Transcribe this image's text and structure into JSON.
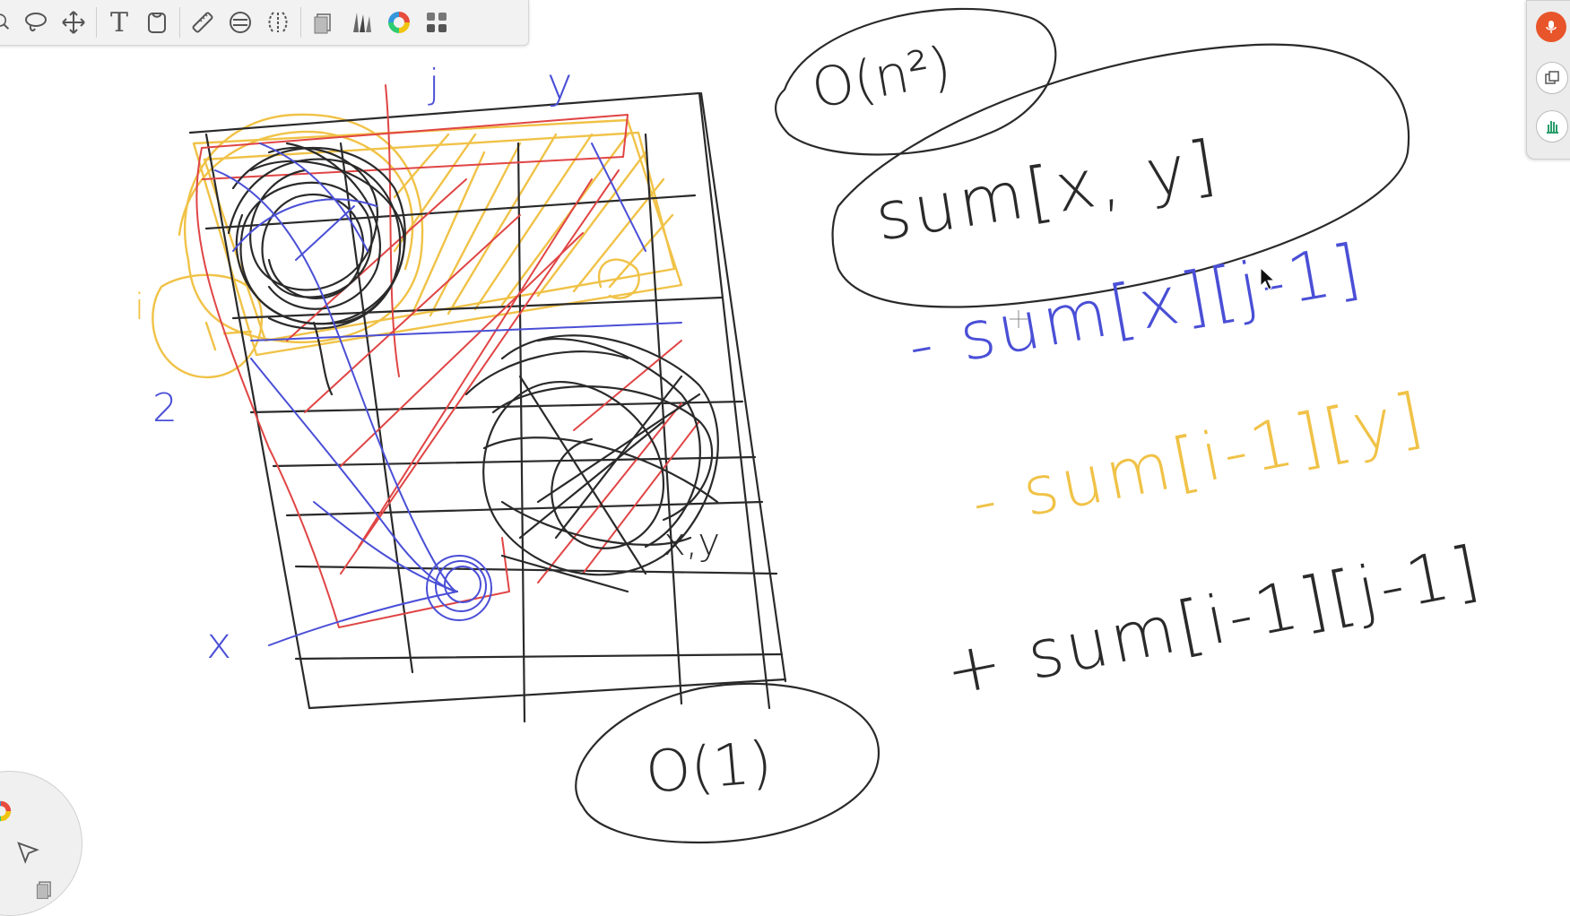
{
  "toolbar": {
    "tools": [
      "magnify-icon",
      "lasso-icon",
      "move-icon",
      "text-tool-icon",
      "fill-icon",
      "ruler-icon",
      "symmetry-icon",
      "perspective-icon",
      "layers-icon",
      "brush-library-icon",
      "color-wheel-icon",
      "menu-grid-icon"
    ],
    "text_tool_glyph": "T"
  },
  "sidepanel": {
    "buttons": [
      "mic-icon",
      "window-icon",
      "hand-icon"
    ],
    "accent": "#e8552a"
  },
  "colors": {
    "black": "#2a2a2a",
    "red": "#e04545",
    "blue": "#4a4fd6",
    "yellow": "#f0c247"
  },
  "notes": {
    "complexity_n2": "O(n²)",
    "sum_xy": "sum[x, y]",
    "minus_sum_x_j": "- sum[x][j-1]",
    "minus_sum_i_y": "- sum[i-1][y]",
    "plus_sum_i_j": "+ sum[i-1][j-1]",
    "complexity_1": "O(1)",
    "label_j": "j",
    "label_y": "y",
    "label_i": "i",
    "label_x": "x",
    "label_2": "2",
    "label_xy": "x,y"
  }
}
